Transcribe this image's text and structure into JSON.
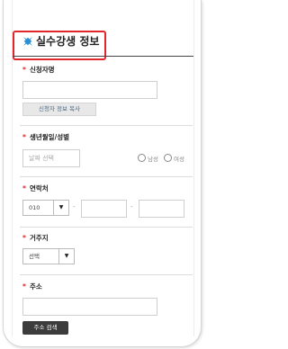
{
  "header": {
    "title": "실수강생 정보",
    "icon": "cross-logo-icon",
    "highlight_color": "#e1262c",
    "icon_color": "#2a8fd6"
  },
  "fields": {
    "applicant_name": {
      "required_mark": "*",
      "label": "신청자명",
      "value": ""
    },
    "copy_button": "신청자 정보 복사",
    "birth_gender": {
      "required_mark": "*",
      "label": "생년월일/성별",
      "date_placeholder": "날짜 선택",
      "male": "남성",
      "female": "여성"
    },
    "contact": {
      "required_mark": "*",
      "label": "연락처",
      "prefix": "010",
      "separator": "-",
      "middle": "",
      "last": ""
    },
    "residence": {
      "required_mark": "*",
      "label": "거주지",
      "selected": "선택"
    },
    "address": {
      "required_mark": "*",
      "label": "주소",
      "value": "",
      "search_button": "주소 검색"
    }
  }
}
